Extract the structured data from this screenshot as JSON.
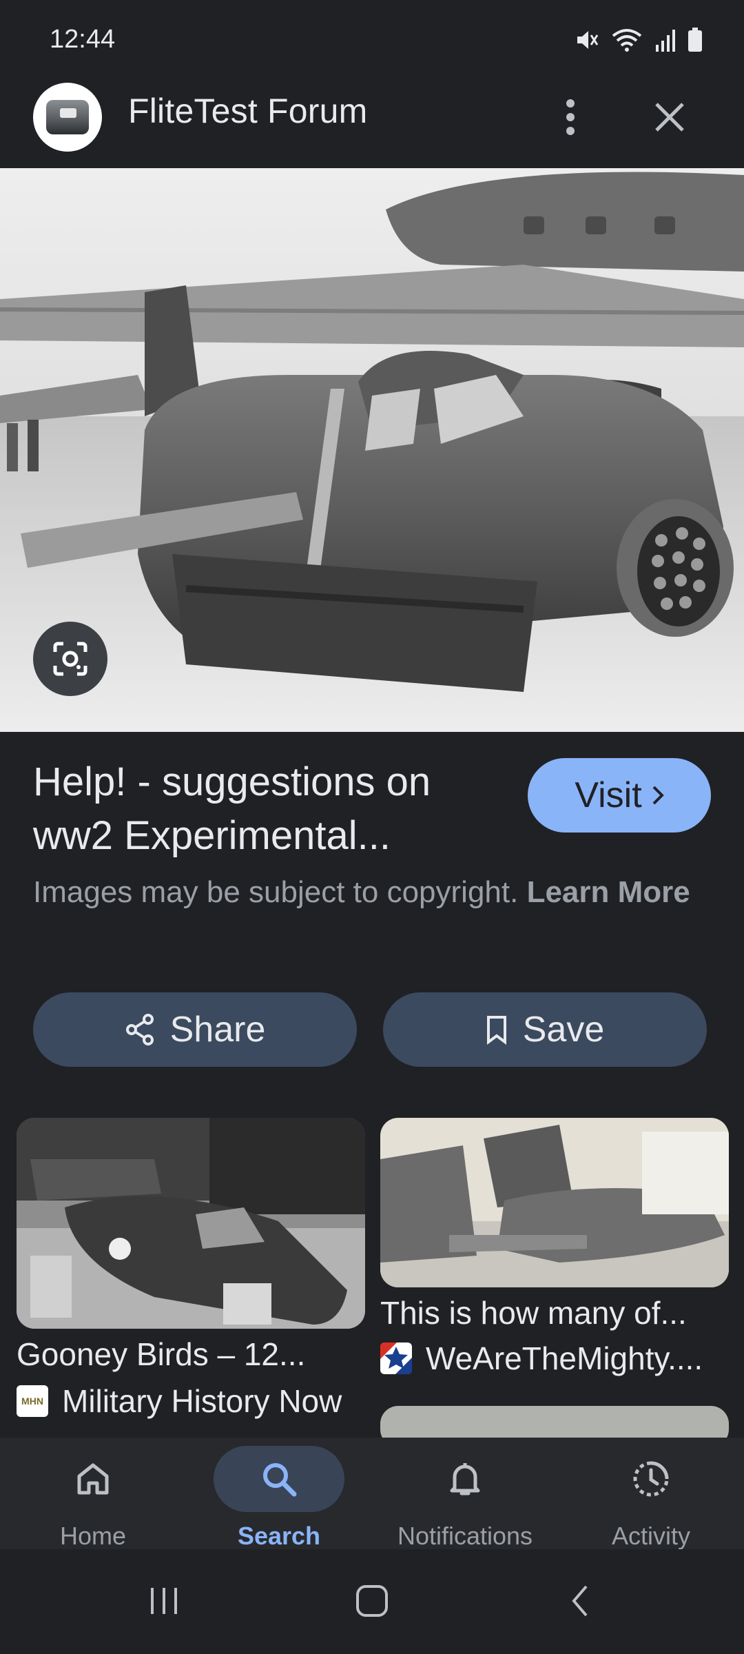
{
  "status_bar": {
    "time": "12:44"
  },
  "header": {
    "site_title": "FliteTest Forum"
  },
  "result": {
    "title": "Help! - suggestions on ww2 Experimental...",
    "visit_label": "Visit",
    "copyright_text": "Images may be subject to copyright.",
    "copyright_link": "Learn More"
  },
  "actions": {
    "share_label": "Share",
    "save_label": "Save"
  },
  "related": [
    {
      "title": "Gooney Birds – 12...",
      "source": "Military History Now",
      "favicon_text": "MHN"
    },
    {
      "title": "This is how many of...",
      "source": "WeAreTheMighty...."
    }
  ],
  "bottom_nav": {
    "items": [
      {
        "label": "Home",
        "icon": "home-icon"
      },
      {
        "label": "Search",
        "icon": "search-icon",
        "active": true
      },
      {
        "label": "Notifications",
        "icon": "bell-icon"
      },
      {
        "label": "Activity",
        "icon": "activity-icon"
      }
    ]
  },
  "colors": {
    "background": "#202124",
    "accent": "#8ab4f8",
    "button": "#3c4a5f",
    "nav_bg": "#28292c"
  }
}
